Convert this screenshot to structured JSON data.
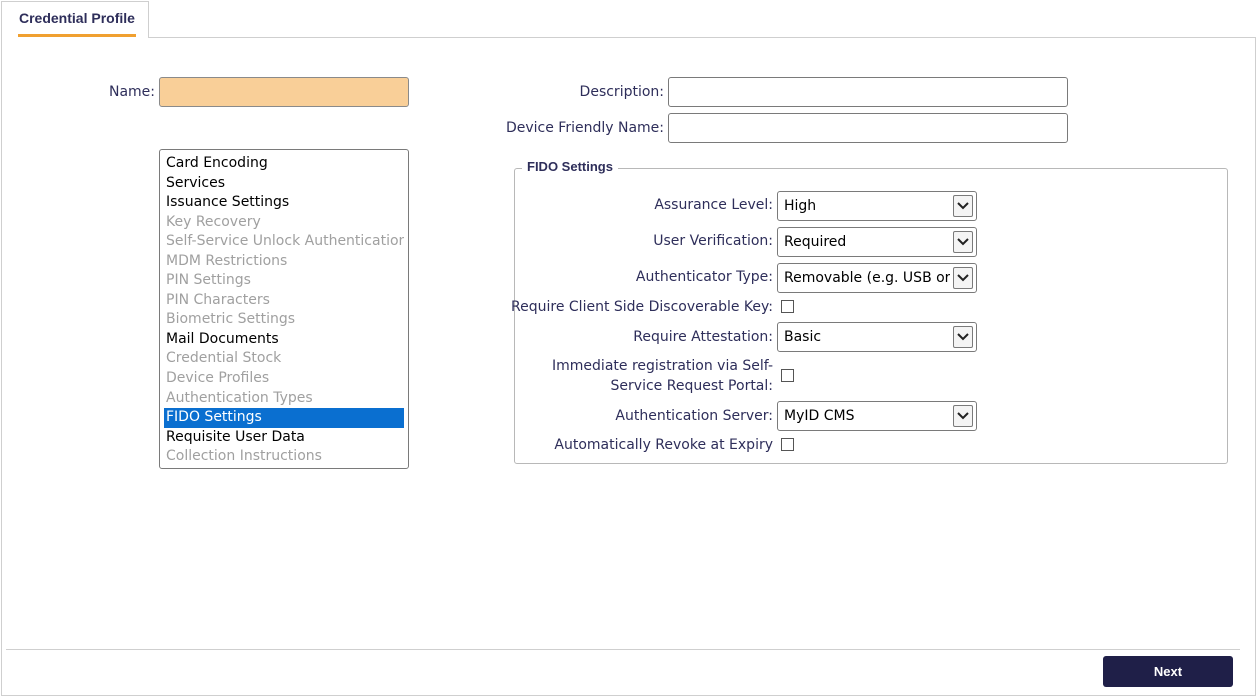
{
  "tab": {
    "label": "Credential Profile"
  },
  "form": {
    "name_label": "Name:",
    "name_value": "",
    "description_label": "Description:",
    "description_value": "",
    "device_friendly_name_label": "Device Friendly Name:",
    "device_friendly_name_value": ""
  },
  "categories": {
    "items": [
      {
        "label": "Card Encoding",
        "state": "enabled"
      },
      {
        "label": "Services",
        "state": "enabled"
      },
      {
        "label": "Issuance Settings",
        "state": "enabled"
      },
      {
        "label": "Key Recovery",
        "state": "disabled"
      },
      {
        "label": "Self-Service Unlock Authentication",
        "state": "disabled"
      },
      {
        "label": "MDM Restrictions",
        "state": "disabled"
      },
      {
        "label": "PIN Settings",
        "state": "disabled"
      },
      {
        "label": "PIN Characters",
        "state": "disabled"
      },
      {
        "label": "Biometric Settings",
        "state": "disabled"
      },
      {
        "label": "Mail Documents",
        "state": "enabled"
      },
      {
        "label": "Credential Stock",
        "state": "disabled"
      },
      {
        "label": "Device Profiles",
        "state": "disabled"
      },
      {
        "label": "Authentication Types",
        "state": "disabled"
      },
      {
        "label": "FIDO Settings",
        "state": "selected"
      },
      {
        "label": "Requisite User Data",
        "state": "enabled"
      },
      {
        "label": "Collection Instructions",
        "state": "disabled"
      }
    ]
  },
  "fido": {
    "legend": "FIDO Settings",
    "assurance_level": {
      "label": "Assurance Level:",
      "value": "High"
    },
    "user_verification": {
      "label": "User Verification:",
      "value": "Required"
    },
    "authenticator_type": {
      "label": "Authenticator Type:",
      "value": "Removable (e.g. USB or smart card)"
    },
    "require_discoverable_key": {
      "label": "Require Client Side Discoverable Key:",
      "checked": false
    },
    "require_attestation": {
      "label": "Require Attestation:",
      "value": "Basic"
    },
    "immediate_registration": {
      "label": "Immediate registration via Self-Service Request Portal:",
      "checked": false
    },
    "authentication_server": {
      "label": "Authentication Server:",
      "value": "MyID CMS"
    },
    "auto_revoke": {
      "label": "Automatically Revoke at Expiry",
      "checked": false
    }
  },
  "footer": {
    "next_label": "Next"
  },
  "colors": {
    "accent": "#f0a030",
    "required_field": "#f9cf98",
    "selection": "#0a6fd0",
    "primary_button": "#1f1f48",
    "label_text": "#2e2e5a"
  }
}
